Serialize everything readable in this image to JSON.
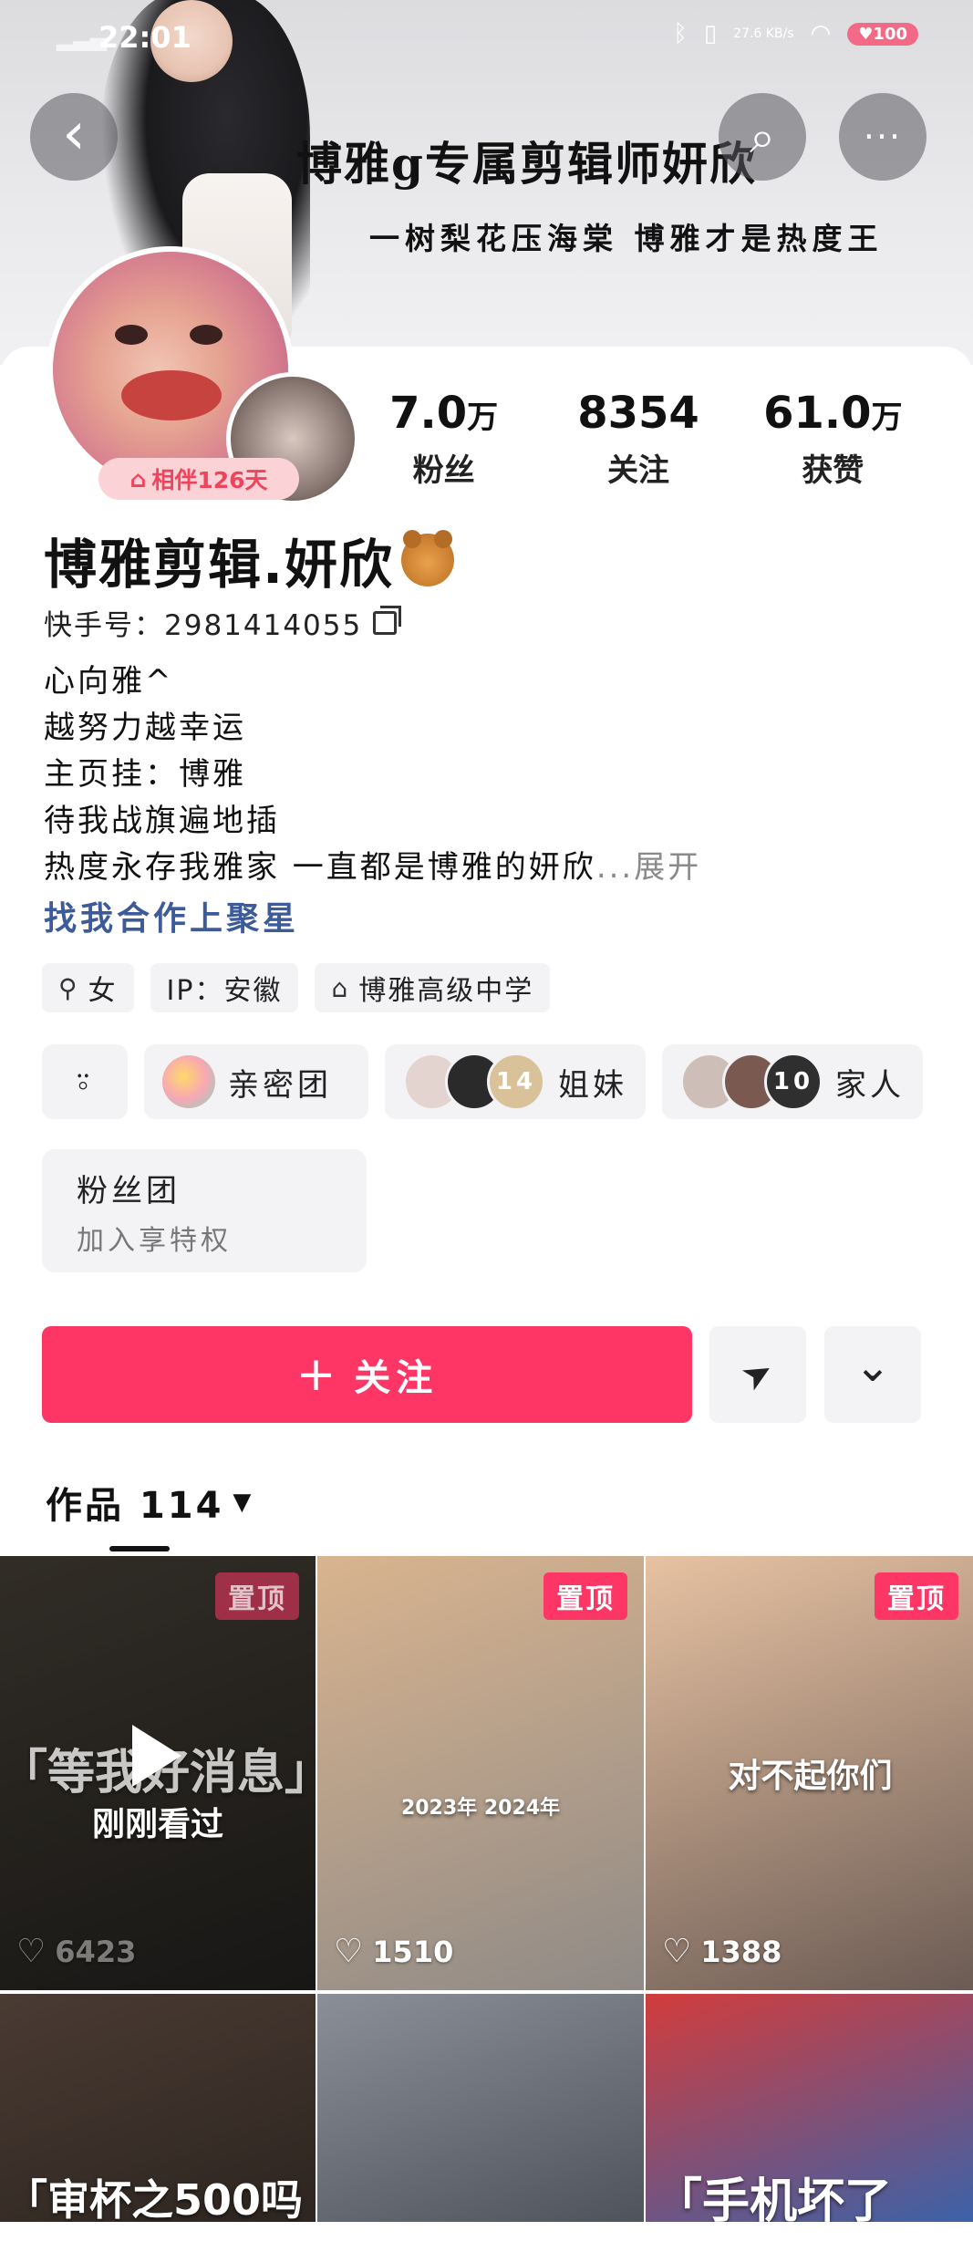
{
  "status_bar": {
    "time": "22:01",
    "network_speed": "27.6 KB/s",
    "battery": "100"
  },
  "banner": {
    "title": "博雅g专属剪辑师妍欣",
    "subtitle": "一树梨花压海棠 博雅才是热度王"
  },
  "header_buttons": {
    "back": "‹",
    "search": "⌕",
    "more": "···"
  },
  "profile": {
    "companion_badge": "相伴126天",
    "stats": [
      {
        "value": "7.0",
        "unit": "万",
        "label": "粉丝"
      },
      {
        "value": "8354",
        "unit": "",
        "label": "关注"
      },
      {
        "value": "61.0",
        "unit": "万",
        "label": "获赞"
      }
    ],
    "nickname": "博雅剪辑.妍欣",
    "kuaishou_id": "快手号：2981414055",
    "bio_lines": [
      "心向雅^",
      "越努力越幸运",
      "主页挂：博雅",
      "待我战旗遍地插",
      "热度永存我雅家 一直都是博雅的妍欣"
    ],
    "bio_more": "...展开",
    "cooperation_link": "找我合作上聚星",
    "tags": [
      {
        "icon": "⚲",
        "label": "女"
      },
      {
        "icon": "",
        "label": "IP：安徽"
      },
      {
        "icon": "⌂",
        "label": "博雅高级中学"
      }
    ],
    "groups": [
      {
        "label": "亲密团"
      },
      {
        "count": "14",
        "label": "姐妹"
      },
      {
        "count": "10",
        "label": "家人"
      }
    ],
    "fan_club": {
      "title": "粉丝团",
      "subtitle": "加入享特权"
    }
  },
  "actions": {
    "follow": "关注",
    "follow_icon": "+",
    "send_icon": "➤",
    "more_icon": "⌄"
  },
  "works_tab": {
    "label": "作品 114"
  },
  "videos": [
    {
      "pinned": "置顶",
      "likes": "6423",
      "overlay": "「等我好消息」",
      "status": "刚刚看过",
      "colors": [
        "#5a5246",
        "#2c2a27"
      ]
    },
    {
      "pinned": "置顶",
      "likes": "1510",
      "overlay": "2023年      2024年",
      "colors": [
        "#d9b48f",
        "#8f8a86"
      ]
    },
    {
      "pinned": "置顶",
      "likes": "1388",
      "overlay": "对不起你们",
      "colors": [
        "#e7c2a2",
        "#6b5b54"
      ]
    },
    {
      "overlay": "「审杯之500吗",
      "colors": [
        "#4a3b33",
        "#2d2520"
      ]
    },
    {
      "overlay": "",
      "colors": [
        "#8a8f98",
        "#4e535c"
      ]
    },
    {
      "overlay": "「手机坏了",
      "colors": [
        "#d23c3c",
        "#3b62a8"
      ]
    }
  ]
}
